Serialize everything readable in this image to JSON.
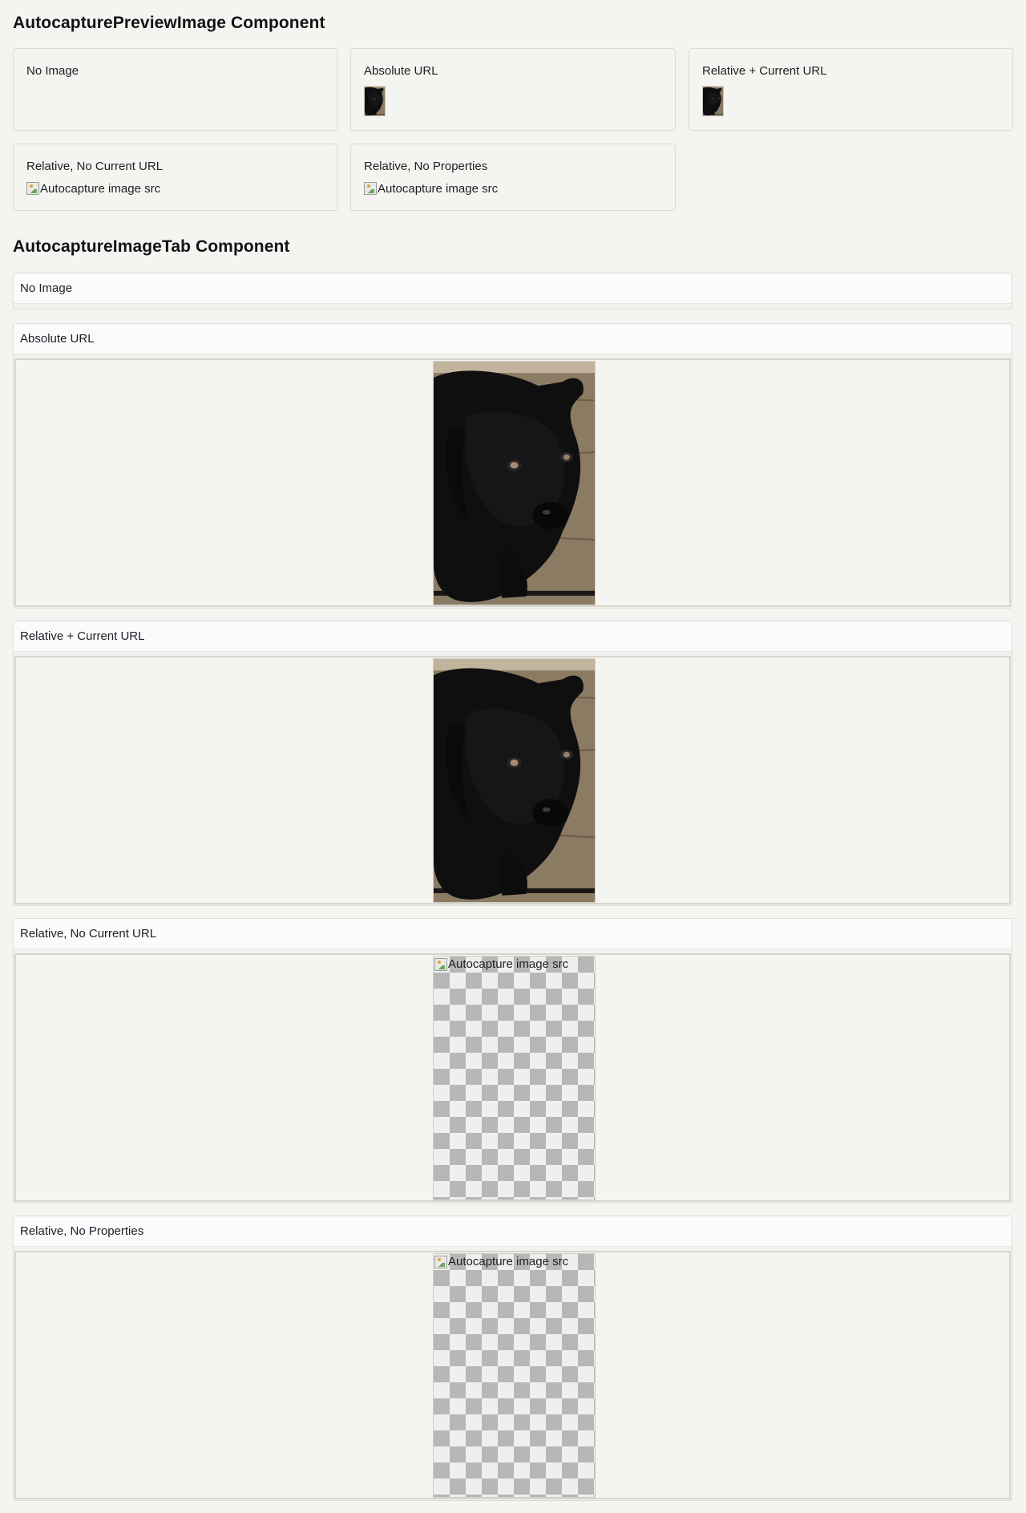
{
  "sections": {
    "preview_title": "AutocapturePreviewImage Component",
    "tab_title": "AutocaptureImageTab Component"
  },
  "preview_cards": [
    {
      "label": "No Image",
      "state": "empty"
    },
    {
      "label": "Absolute URL",
      "state": "thumbnail"
    },
    {
      "label": "Relative + Current URL",
      "state": "thumbnail"
    },
    {
      "label": "Relative, No Current URL",
      "state": "broken",
      "alt": "Autocapture image src"
    },
    {
      "label": "Relative, No Properties",
      "state": "broken",
      "alt": "Autocapture image src"
    }
  ],
  "tabs": [
    {
      "label": "No Image",
      "state": "empty"
    },
    {
      "label": "Absolute URL",
      "state": "image"
    },
    {
      "label": "Relative + Current URL",
      "state": "image"
    },
    {
      "label": "Relative, No Current URL",
      "state": "broken",
      "alt": "Autocapture image src"
    },
    {
      "label": "Relative, No Properties",
      "state": "broken",
      "alt": "Autocapture image src"
    }
  ],
  "icons": {
    "broken_image": "broken-image-icon",
    "puppy_image": "puppy-photo"
  },
  "colors": {
    "background": "#f4f4f0",
    "card_border": "#dcdcd6",
    "tab_header": "#fafbfc",
    "checker_dark": "#b7b7b7",
    "checker_light": "#efefef"
  }
}
